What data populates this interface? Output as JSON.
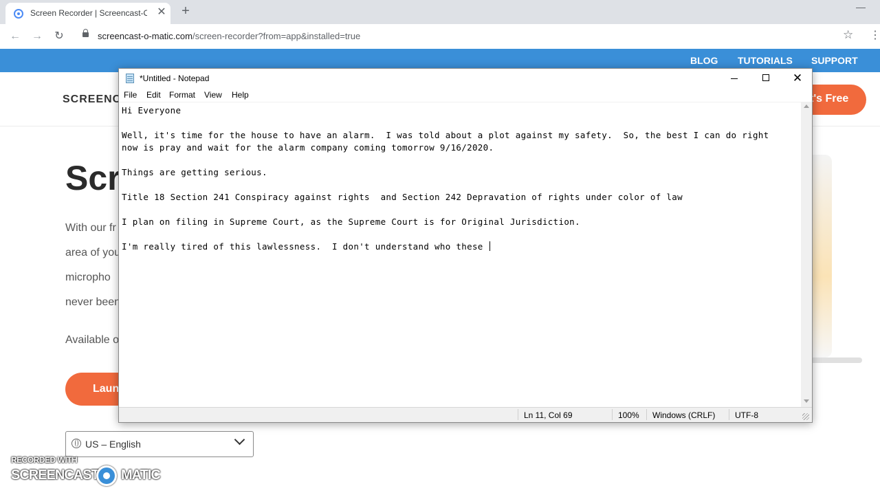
{
  "browser": {
    "tab_title": "Screen Recorder | Screencast-O-Matic",
    "url_host": "screencast-o-matic.com",
    "url_path": "/screen-recorder?from=app&installed=true"
  },
  "site": {
    "nav": [
      "BLOG",
      "TUTORIALS",
      "SUPPORT"
    ],
    "logo_text": "SCREENCA",
    "cta_label": "t's Free",
    "hero_title": "Scre",
    "hero_lines": [
      "With our fr",
      "area of you",
      "micropho",
      "never been"
    ],
    "available_text": "Available o",
    "launch_label": "Laun",
    "language": "US – English"
  },
  "watermark": {
    "top": "RECORDED WITH",
    "left": "SCREENCAST",
    "right": "MATIC"
  },
  "notepad": {
    "title": "*Untitled - Notepad",
    "menu": [
      "File",
      "Edit",
      "Format",
      "View",
      "Help"
    ],
    "lines": [
      "Hi Everyone",
      "",
      "Well, it's time for the house to have an alarm.  I was told about a plot against my safety.  So, the best I can do right",
      "now is pray and wait for the alarm company coming tomorrow 9/16/2020.",
      "",
      "Things are getting serious.",
      "",
      "Title 18 Section 241 Conspiracy against rights  and Section 242 Depravation of rights under color of law",
      "",
      "I plan on filing in Supreme Court, as the Supreme Court is for Original Jurisdiction.",
      "",
      "I'm really tired of this lawlessness.  I don't understand who these "
    ],
    "status": {
      "position": "Ln 11, Col 69",
      "zoom": "100%",
      "line_ending": "Windows (CRLF)",
      "encoding": "UTF-8"
    }
  }
}
